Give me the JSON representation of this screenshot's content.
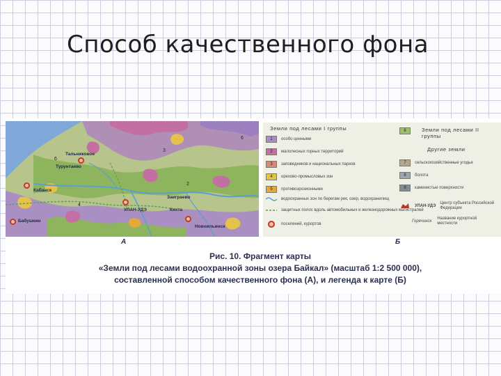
{
  "slide": {
    "title": "Способ качественного фона"
  },
  "map": {
    "city_labels": [
      "УЛАН-УДЭ",
      "Заиграево",
      "Кяхта",
      "Новоильинск",
      "Турунтаево",
      "Тальниковое",
      "Кабанск",
      "Бабушкин"
    ],
    "numbers": [
      "1",
      "2",
      "3",
      "4",
      "5",
      "6",
      "7",
      "8",
      "9"
    ],
    "caption_letter": "А"
  },
  "legend": {
    "group1_title": "Земли под лесами I группы",
    "group2_title": "Земли под лесами II группы",
    "other_title": "Другие земли",
    "group1_items": [
      {
        "num": "1",
        "color": "#a78fc4",
        "label": "особо ценными"
      },
      {
        "num": "2",
        "color": "#c36fa3",
        "label": "малолесных горных территорий"
      },
      {
        "num": "3",
        "color": "#d58b7b",
        "label": "заповедников и национальных парков"
      },
      {
        "num": "4",
        "color": "#e6c24a",
        "label": "орехово-промысловых зон"
      },
      {
        "num": "5",
        "color": "#e5a83a",
        "label": "противоэрозионными"
      }
    ],
    "group2_item": {
      "num": "6",
      "color": "#9fbf6e"
    },
    "other_items": [
      {
        "num": "7",
        "color": "#b3a98a",
        "label": "сельскохозяйственные угодья"
      },
      {
        "num": "8",
        "color": "#9aa7b3",
        "label": "болота"
      },
      {
        "num": "9",
        "color": "#7f8d99",
        "label": "каменистые поверхности"
      }
    ],
    "line_items": [
      "водоохранных зон по берегам рек, озер, водохранилищ",
      "защитных полос вдоль автомобильных и железнодорожных магистралей",
      "поселений, курортов"
    ],
    "symbol_items": [
      {
        "name": "УЛАН-УДЭ",
        "label": "Центр субъекта Российской Федерации"
      },
      {
        "name": "Горячинск",
        "label": "Название курортной местности"
      }
    ],
    "caption_letter": "Б"
  },
  "caption": {
    "line1": "Рис. 10. Фрагмент карты",
    "line2": "«Земли под лесами водоохранной зоны озера Байкал» (масштаб 1:2 500 000),",
    "line3": "составленной способом качественного фона (А), и легенда к карте (Б)"
  },
  "colors": {
    "lake": "#7fa8d8",
    "forest_green": "#8fb45e",
    "purple": "#a78fc4",
    "magenta": "#c36fa3",
    "yellow": "#e6c24a",
    "river": "#5a9fd0"
  }
}
